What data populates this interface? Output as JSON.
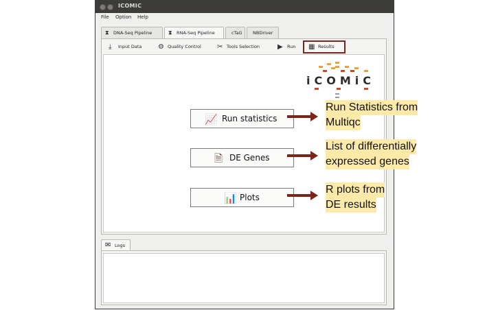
{
  "window": {
    "title": "ICOMIC"
  },
  "menu": [
    "File",
    "Option",
    "Help"
  ],
  "pipeline_tabs": [
    {
      "label": "DNA-Seq Pipeline",
      "icon": "dna-icon"
    },
    {
      "label": "RNA-Seq Pipeline",
      "icon": "rna-icon",
      "active": true
    },
    {
      "label": "cTaG"
    },
    {
      "label": "NBDriver"
    }
  ],
  "sub_tabs": [
    {
      "label": "Input Data",
      "icon": "download-icon"
    },
    {
      "label": "Quality Control",
      "icon": "gear-icon"
    },
    {
      "label": "Tools Selection",
      "icon": "tools-icon"
    },
    {
      "label": "Run",
      "icon": "play-icon"
    },
    {
      "label": "Results",
      "icon": "table-icon",
      "active": true
    }
  ],
  "logo": {
    "text": "iCOMiC"
  },
  "result_buttons": [
    {
      "label": "Run statistics",
      "icon": "chart-trend-icon",
      "annotation": [
        "Run Statistics from",
        "Multiqc"
      ]
    },
    {
      "label": "DE Genes",
      "icon": "document-icon",
      "annotation": [
        "List of differentially",
        "expressed genes"
      ]
    },
    {
      "label": "Plots",
      "icon": "bar-chart-icon",
      "annotation": [
        "R plots from",
        "DE results"
      ]
    }
  ],
  "logs": {
    "label": "Logs",
    "icon": "speech-bubble-icon"
  },
  "colors": {
    "highlight": "#7b2418",
    "annotation_bg": "#fde9a8",
    "titlebar": "#3d3c38"
  }
}
